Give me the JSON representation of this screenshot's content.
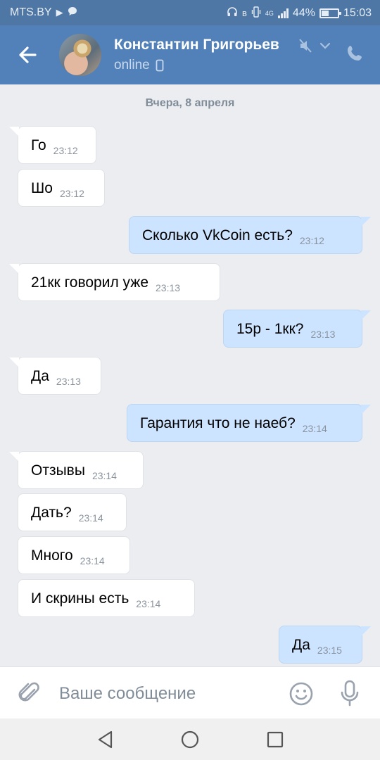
{
  "status_bar": {
    "carrier": "MTS.BY",
    "battery_percent": "44%",
    "battery_level": 0.44,
    "time": "15:03",
    "network": "4G"
  },
  "header": {
    "contact_name": "Константин Григорьев",
    "presence": "online",
    "icons": [
      "back-arrow-icon",
      "mute-icon",
      "chevron-down-icon",
      "phone-icon",
      "mobile-device-icon"
    ]
  },
  "conversation": {
    "date_label": "Вчера, 8 апреля",
    "messages": [
      {
        "direction": "in",
        "text": "Го",
        "time": "23:12"
      },
      {
        "direction": "in",
        "text": "Шо",
        "time": "23:12"
      },
      {
        "direction": "out",
        "text": "Сколько VkCoin есть?",
        "time": "23:12"
      },
      {
        "direction": "in",
        "text": "21кк говорил уже",
        "time": "23:13"
      },
      {
        "direction": "out",
        "text": "15р - 1кк?",
        "time": "23:13"
      },
      {
        "direction": "in",
        "text": "Да",
        "time": "23:13"
      },
      {
        "direction": "out",
        "text": "Гарантия что не наеб?",
        "time": "23:14"
      },
      {
        "direction": "in",
        "text": "Отзывы",
        "time": "23:14"
      },
      {
        "direction": "in",
        "text": "Дать?",
        "time": "23:14"
      },
      {
        "direction": "in",
        "text": "Много",
        "time": "23:14"
      },
      {
        "direction": "in",
        "text": "И скрины есть",
        "time": "23:14"
      },
      {
        "direction": "out",
        "text": "Да",
        "time": "23:15"
      }
    ]
  },
  "composer": {
    "placeholder": "Ваше сообщение",
    "value": "",
    "icons": [
      "paperclip-icon",
      "emoji-icon",
      "microphone-icon"
    ]
  },
  "colors": {
    "header": "#5181b8",
    "status_bar": "#4f77a5",
    "incoming_bubble": "#ffffff",
    "outgoing_bubble": "#cce4ff",
    "background": "#ebedf0"
  }
}
